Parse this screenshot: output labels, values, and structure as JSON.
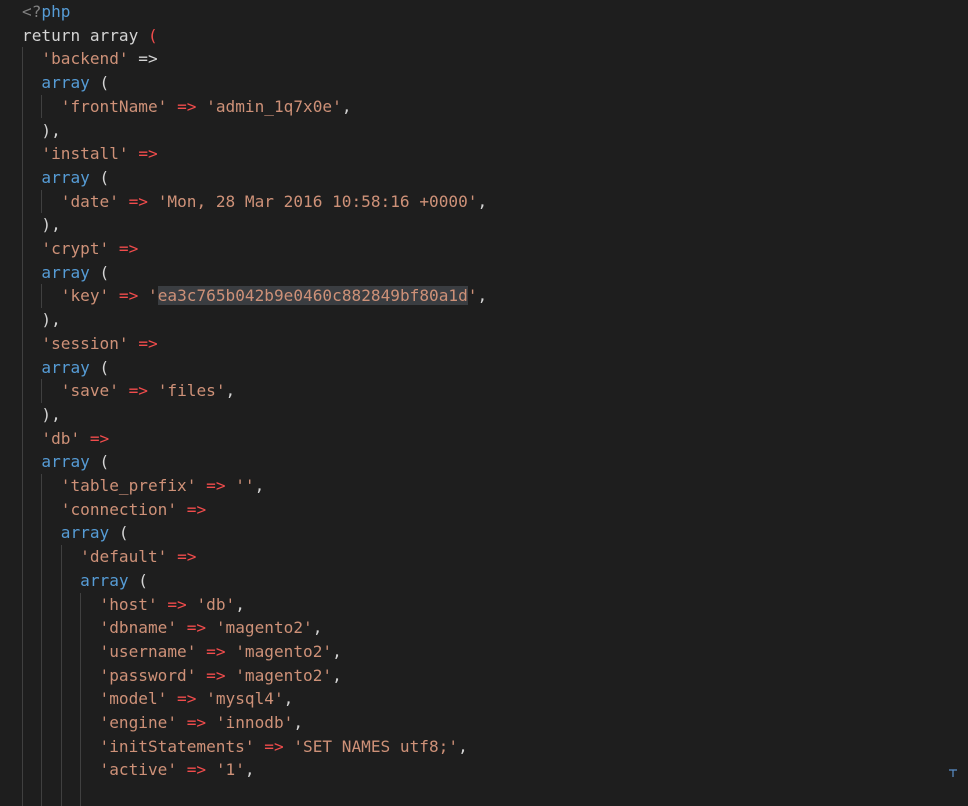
{
  "colors": {
    "background": "#1e1e1e",
    "string": "#ce9178",
    "keyword": "#569cd6",
    "arrow": "#f14c4c",
    "plain": "#d4d4d4"
  },
  "code": {
    "lines": [
      [
        {
          "t": "tag",
          "v": "<?"
        },
        {
          "t": "php",
          "v": "php"
        }
      ],
      [
        {
          "t": "kw",
          "v": "return "
        },
        {
          "t": "kw",
          "v": "array "
        },
        {
          "t": "arrow-red",
          "v": "("
        }
      ],
      [
        {
          "t": "op",
          "v": "  "
        },
        {
          "t": "str",
          "v": "'backend'"
        },
        {
          "t": "op",
          "v": " =>"
        }
      ],
      [
        {
          "t": "op",
          "v": "  "
        },
        {
          "t": "fn",
          "v": "array"
        },
        {
          "t": "op",
          "v": " ("
        }
      ],
      [
        {
          "t": "op",
          "v": "    "
        },
        {
          "t": "str",
          "v": "'frontName'"
        },
        {
          "t": "op",
          "v": " "
        },
        {
          "t": "arrow-red",
          "v": "=>"
        },
        {
          "t": "op",
          "v": " "
        },
        {
          "t": "str",
          "v": "'admin_1q7x0e'"
        },
        {
          "t": "op",
          "v": ","
        }
      ],
      [
        {
          "t": "op",
          "v": "  ),"
        }
      ],
      [
        {
          "t": "op",
          "v": "  "
        },
        {
          "t": "str",
          "v": "'install'"
        },
        {
          "t": "op",
          "v": " "
        },
        {
          "t": "arrow-red",
          "v": "=>"
        }
      ],
      [
        {
          "t": "op",
          "v": "  "
        },
        {
          "t": "fn",
          "v": "array"
        },
        {
          "t": "op",
          "v": " ("
        }
      ],
      [
        {
          "t": "op",
          "v": "    "
        },
        {
          "t": "str",
          "v": "'date'"
        },
        {
          "t": "op",
          "v": " "
        },
        {
          "t": "arrow-red",
          "v": "=>"
        },
        {
          "t": "op",
          "v": " "
        },
        {
          "t": "str",
          "v": "'Mon, 28 Mar 2016 10:58:16 +0000'"
        },
        {
          "t": "op",
          "v": ","
        }
      ],
      [
        {
          "t": "op",
          "v": "  ),"
        }
      ],
      [
        {
          "t": "op",
          "v": "  "
        },
        {
          "t": "str",
          "v": "'crypt'"
        },
        {
          "t": "op",
          "v": " "
        },
        {
          "t": "arrow-red",
          "v": "=>"
        }
      ],
      [
        {
          "t": "op",
          "v": "  "
        },
        {
          "t": "fn",
          "v": "array"
        },
        {
          "t": "op",
          "v": " ("
        }
      ],
      [
        {
          "t": "op",
          "v": "    "
        },
        {
          "t": "str",
          "v": "'key'"
        },
        {
          "t": "op",
          "v": " "
        },
        {
          "t": "arrow-red",
          "v": "=>"
        },
        {
          "t": "op",
          "v": " "
        },
        {
          "t": "str",
          "v": "'"
        },
        {
          "t": "str-hl",
          "v": "ea3c765b042b9e0460c882849bf80a1d"
        },
        {
          "t": "str",
          "v": "'"
        },
        {
          "t": "op",
          "v": ","
        }
      ],
      [
        {
          "t": "op",
          "v": "  ),"
        }
      ],
      [
        {
          "t": "op",
          "v": "  "
        },
        {
          "t": "str",
          "v": "'session'"
        },
        {
          "t": "op",
          "v": " "
        },
        {
          "t": "arrow-red",
          "v": "=>"
        }
      ],
      [
        {
          "t": "op",
          "v": "  "
        },
        {
          "t": "fn",
          "v": "array"
        },
        {
          "t": "op",
          "v": " ("
        }
      ],
      [
        {
          "t": "op",
          "v": "    "
        },
        {
          "t": "str",
          "v": "'save'"
        },
        {
          "t": "op",
          "v": " "
        },
        {
          "t": "arrow-red",
          "v": "=>"
        },
        {
          "t": "op",
          "v": " "
        },
        {
          "t": "str",
          "v": "'files'"
        },
        {
          "t": "op",
          "v": ","
        }
      ],
      [
        {
          "t": "op",
          "v": "  ),"
        }
      ],
      [
        {
          "t": "op",
          "v": "  "
        },
        {
          "t": "str",
          "v": "'db'"
        },
        {
          "t": "op",
          "v": " "
        },
        {
          "t": "arrow-red",
          "v": "=>"
        }
      ],
      [
        {
          "t": "op",
          "v": "  "
        },
        {
          "t": "fn",
          "v": "array"
        },
        {
          "t": "op",
          "v": " ("
        }
      ],
      [
        {
          "t": "op",
          "v": "    "
        },
        {
          "t": "str",
          "v": "'table_prefix'"
        },
        {
          "t": "op",
          "v": " "
        },
        {
          "t": "arrow-red",
          "v": "=>"
        },
        {
          "t": "op",
          "v": " "
        },
        {
          "t": "str",
          "v": "''"
        },
        {
          "t": "op",
          "v": ","
        }
      ],
      [
        {
          "t": "op",
          "v": "    "
        },
        {
          "t": "str",
          "v": "'connection'"
        },
        {
          "t": "op",
          "v": " "
        },
        {
          "t": "arrow-red",
          "v": "=>"
        }
      ],
      [
        {
          "t": "op",
          "v": "    "
        },
        {
          "t": "fn",
          "v": "array"
        },
        {
          "t": "op",
          "v": " ("
        }
      ],
      [
        {
          "t": "op",
          "v": "      "
        },
        {
          "t": "str",
          "v": "'default'"
        },
        {
          "t": "op",
          "v": " "
        },
        {
          "t": "arrow-red",
          "v": "=>"
        }
      ],
      [
        {
          "t": "op",
          "v": "      "
        },
        {
          "t": "fn",
          "v": "array"
        },
        {
          "t": "op",
          "v": " ("
        }
      ],
      [
        {
          "t": "op",
          "v": "        "
        },
        {
          "t": "str",
          "v": "'host'"
        },
        {
          "t": "op",
          "v": " "
        },
        {
          "t": "arrow-red",
          "v": "=>"
        },
        {
          "t": "op",
          "v": " "
        },
        {
          "t": "str",
          "v": "'db'"
        },
        {
          "t": "op",
          "v": ","
        }
      ],
      [
        {
          "t": "op",
          "v": "        "
        },
        {
          "t": "str",
          "v": "'dbname'"
        },
        {
          "t": "op",
          "v": " "
        },
        {
          "t": "arrow-red",
          "v": "=>"
        },
        {
          "t": "op",
          "v": " "
        },
        {
          "t": "str",
          "v": "'magento2'"
        },
        {
          "t": "op",
          "v": ","
        }
      ],
      [
        {
          "t": "op",
          "v": "        "
        },
        {
          "t": "str",
          "v": "'username'"
        },
        {
          "t": "op",
          "v": " "
        },
        {
          "t": "arrow-red",
          "v": "=>"
        },
        {
          "t": "op",
          "v": " "
        },
        {
          "t": "str",
          "v": "'magento2'"
        },
        {
          "t": "op",
          "v": ","
        }
      ],
      [
        {
          "t": "op",
          "v": "        "
        },
        {
          "t": "str",
          "v": "'password'"
        },
        {
          "t": "op",
          "v": " "
        },
        {
          "t": "arrow-red",
          "v": "=>"
        },
        {
          "t": "op",
          "v": " "
        },
        {
          "t": "str",
          "v": "'magento2'"
        },
        {
          "t": "op",
          "v": ","
        }
      ],
      [
        {
          "t": "op",
          "v": "        "
        },
        {
          "t": "str",
          "v": "'model'"
        },
        {
          "t": "op",
          "v": " "
        },
        {
          "t": "arrow-red",
          "v": "=>"
        },
        {
          "t": "op",
          "v": " "
        },
        {
          "t": "str",
          "v": "'mysql4'"
        },
        {
          "t": "op",
          "v": ","
        }
      ],
      [
        {
          "t": "op",
          "v": "        "
        },
        {
          "t": "str",
          "v": "'engine'"
        },
        {
          "t": "op",
          "v": " "
        },
        {
          "t": "arrow-red",
          "v": "=>"
        },
        {
          "t": "op",
          "v": " "
        },
        {
          "t": "str",
          "v": "'innodb'"
        },
        {
          "t": "op",
          "v": ","
        }
      ],
      [
        {
          "t": "op",
          "v": "        "
        },
        {
          "t": "str",
          "v": "'initStatements'"
        },
        {
          "t": "op",
          "v": " "
        },
        {
          "t": "arrow-red",
          "v": "=>"
        },
        {
          "t": "op",
          "v": " "
        },
        {
          "t": "str",
          "v": "'SET NAMES utf8;'"
        },
        {
          "t": "op",
          "v": ","
        }
      ],
      [
        {
          "t": "op",
          "v": "        "
        },
        {
          "t": "str",
          "v": "'active'"
        },
        {
          "t": "op",
          "v": " "
        },
        {
          "t": "arrow-red",
          "v": "=>"
        },
        {
          "t": "op",
          "v": " "
        },
        {
          "t": "str",
          "v": "'1'"
        },
        {
          "t": "op",
          "v": ","
        }
      ]
    ]
  },
  "icons": {
    "corner": "resize-corner-icon"
  }
}
